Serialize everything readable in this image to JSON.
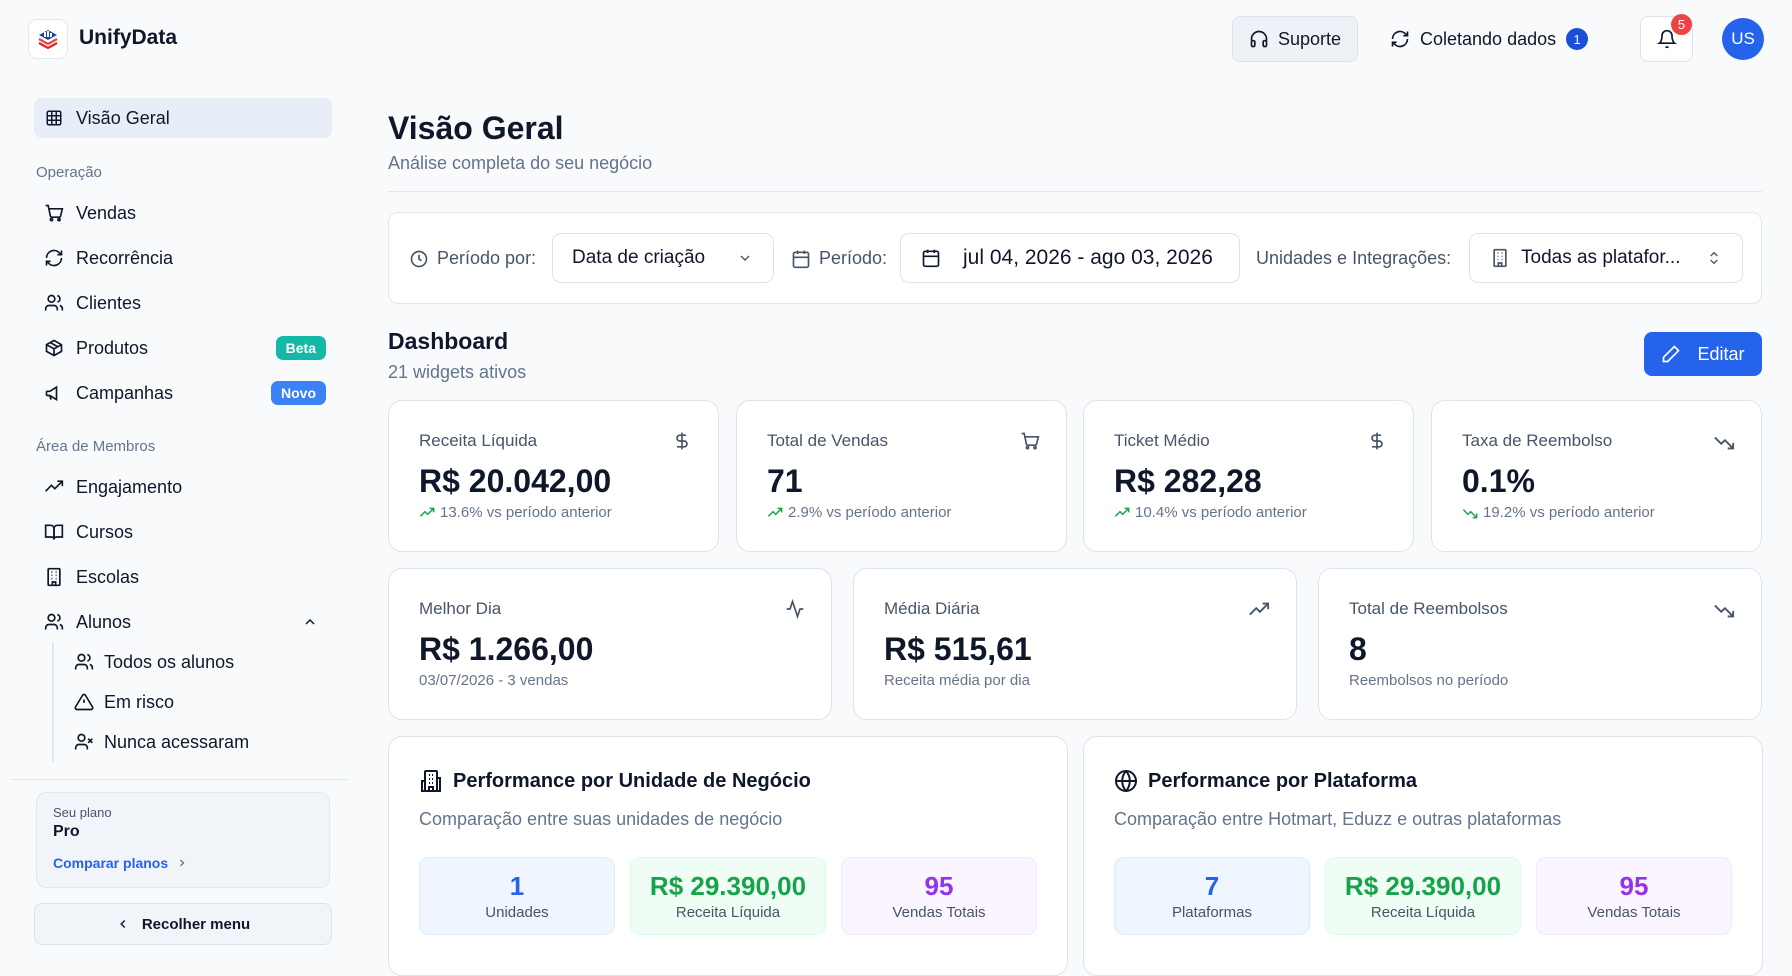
{
  "app": {
    "brand": "UnifyData"
  },
  "header": {
    "support_label": "Suporte",
    "collecting_label": "Coletando dados",
    "collecting_count": "1",
    "notifications_count": "5",
    "avatar_initials": "US"
  },
  "sidebar": {
    "overview": "Visão Geral",
    "section_operacao": "Operação",
    "vendas": "Vendas",
    "recorrencia": "Recorrência",
    "clientes": "Clientes",
    "produtos": "Produtos",
    "produtos_badge": "Beta",
    "campanhas": "Campanhas",
    "campanhas_badge": "Novo",
    "section_membros": "Área de Membros",
    "engajamento": "Engajamento",
    "cursos": "Cursos",
    "escolas": "Escolas",
    "alunos": "Alunos",
    "todos_alunos": "Todos os alunos",
    "em_risco": "Em risco",
    "nunca_acessaram": "Nunca acessaram",
    "plan_label": "Seu plano",
    "plan_name": "Pro",
    "compare_plans": "Comparar planos",
    "collapse_menu": "Recolher menu"
  },
  "page": {
    "title": "Visão Geral",
    "subtitle": "Análise completa do seu negócio"
  },
  "filters": {
    "period_by_label": "Período por:",
    "period_by_value": "Data de criação",
    "period_label": "Período:",
    "period_value": "jul 04, 2026 - ago 03, 2026",
    "units_label": "Unidades e Integrações:",
    "units_value": "Todas as platafor..."
  },
  "dashboard": {
    "title": "Dashboard",
    "subtitle": "21 widgets ativos",
    "edit_label": "Editar"
  },
  "kpis": {
    "receita": {
      "title": "Receita Líquida",
      "value": "R$ 20.042,00",
      "sub": "13.6% vs período anterior"
    },
    "vendas": {
      "title": "Total de Vendas",
      "value": "71",
      "sub": "2.9% vs período anterior"
    },
    "ticket": {
      "title": "Ticket Médio",
      "value": "R$ 282,28",
      "sub": "10.4% vs período anterior"
    },
    "reembolso_taxa": {
      "title": "Taxa de Reembolso",
      "value": "0.1%",
      "sub": "19.2% vs período anterior"
    },
    "melhor_dia": {
      "title": "Melhor Dia",
      "value": "R$ 1.266,00",
      "sub": "03/07/2026 - 3 vendas"
    },
    "media_diaria": {
      "title": "Média Diária",
      "value": "R$ 515,61",
      "sub": "Receita média por dia"
    },
    "total_reembolsos": {
      "title": "Total de Reembolsos",
      "value": "8",
      "sub": "Reembolsos no período"
    }
  },
  "perf_unidade": {
    "title": "Performance por Unidade de Negócio",
    "subtitle": "Comparação entre suas unidades de negócio",
    "stats": [
      {
        "value": "1",
        "label": "Unidades"
      },
      {
        "value": "R$ 29.390,00",
        "label": "Receita Líquida"
      },
      {
        "value": "95",
        "label": "Vendas Totais"
      }
    ]
  },
  "perf_plataforma": {
    "title": "Performance por Plataforma",
    "subtitle": "Comparação entre Hotmart, Eduzz e outras plataformas",
    "stats": [
      {
        "value": "7",
        "label": "Plataformas"
      },
      {
        "value": "R$ 29.390,00",
        "label": "Receita Líquida"
      },
      {
        "value": "95",
        "label": "Vendas Totais"
      }
    ]
  },
  "colors": {
    "primary": "#2563eb",
    "positive": "#16a34a",
    "beta_badge": "#14b8a6",
    "new_badge": "#3b82f6",
    "alert": "#ef4444"
  }
}
